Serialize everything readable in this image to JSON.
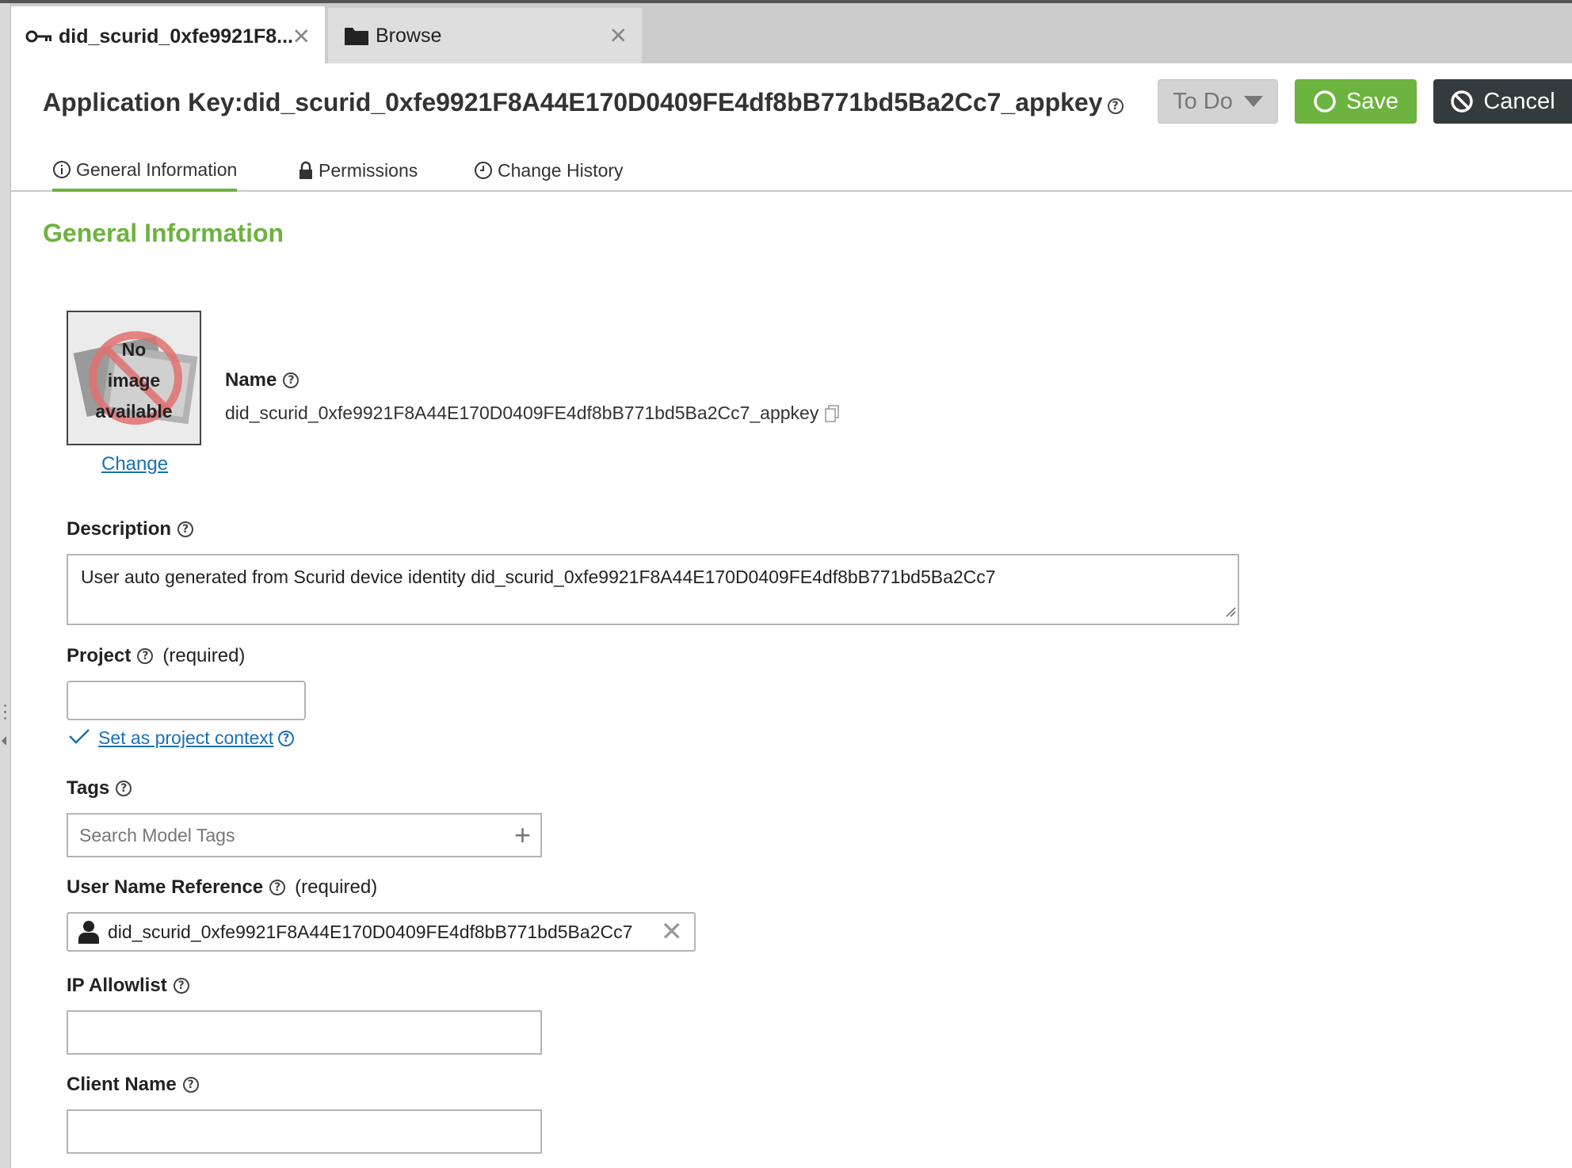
{
  "tabs": [
    {
      "label": "did_scurid_0xfe9921F8...",
      "icon": "key-icon",
      "active": true
    },
    {
      "label": "Browse",
      "icon": "folder-icon",
      "active": false
    }
  ],
  "header": {
    "title": "Application Key:did_scurid_0xfe9921F8A44E170D0409FE4df8bB771bd5Ba2Cc7_appkey",
    "status_label": "To Do",
    "save_label": "Save",
    "cancel_label": "Cancel"
  },
  "subtabs": [
    {
      "label": "General Information",
      "icon": "info-icon"
    },
    {
      "label": "Permissions",
      "icon": "lock-icon"
    },
    {
      "label": "Change History",
      "icon": "clock-icon"
    }
  ],
  "section": {
    "title": "General Information"
  },
  "image": {
    "placeholder_line1": "No",
    "placeholder_line2": "image",
    "placeholder_line3": "available",
    "change_label": "Change"
  },
  "fields": {
    "name_label": "Name",
    "name_value": "did_scurid_0xfe9921F8A44E170D0409FE4df8bB771bd5Ba2Cc7_appkey",
    "description_label": "Description",
    "description_value": "User auto generated from Scurid device identity did_scurid_0xfe9921F8A44E170D0409FE4df8bB771bd5Ba2Cc7",
    "project_label": "Project",
    "required_text": "(required)",
    "project_value": "",
    "project_context_label": "Set as project context",
    "tags_label": "Tags",
    "tags_placeholder": "Search Model Tags",
    "user_ref_label": "User Name Reference",
    "user_ref_value": "did_scurid_0xfe9921F8A44E170D0409FE4df8bB771bd5Ba2Cc7",
    "ip_label": "IP Allowlist",
    "ip_value": "",
    "client_label": "Client Name",
    "client_value": ""
  },
  "colors": {
    "accent": "#6cb33f",
    "cancel_bg": "#333b3e",
    "link": "#1a6fb5",
    "tab_bar": "#cccccc"
  }
}
